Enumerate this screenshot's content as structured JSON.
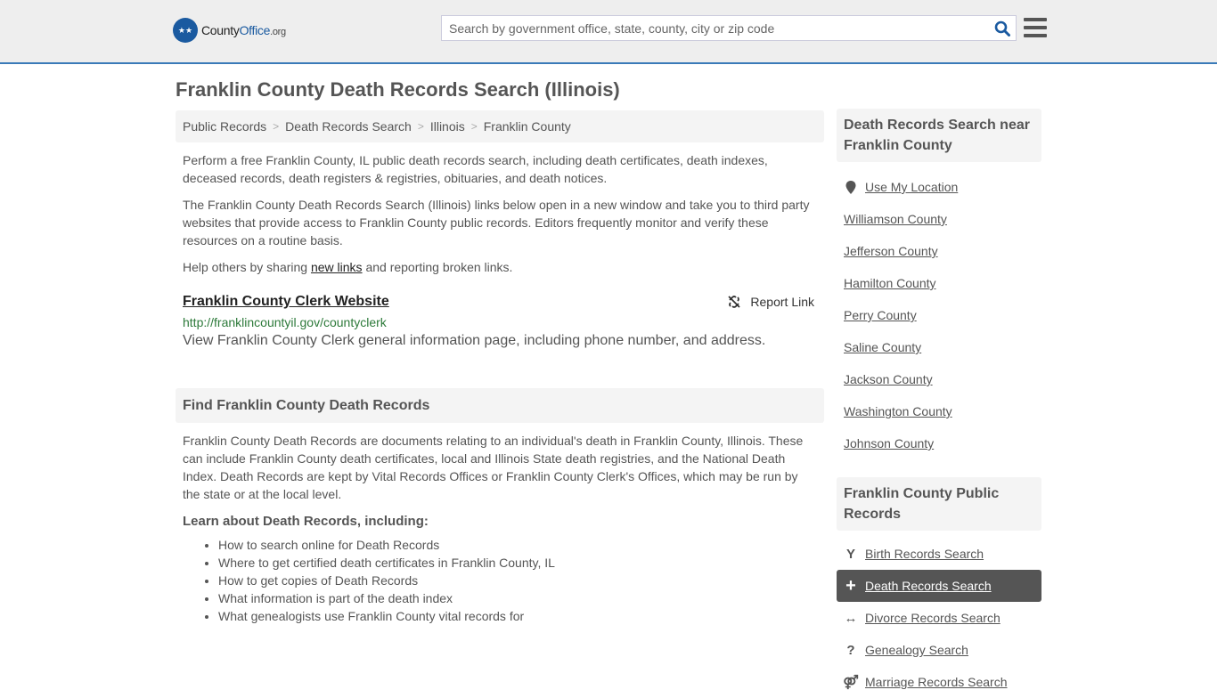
{
  "header": {
    "logo": {
      "name_part1": "County",
      "name_part2": "Office",
      "suffix": ".org"
    },
    "search": {
      "placeholder": "Search by government office, state, county, city or zip code",
      "value": ""
    }
  },
  "page": {
    "title": "Franklin County Death Records Search (Illinois)"
  },
  "breadcrumb": [
    {
      "label": "Public Records"
    },
    {
      "label": "Death Records Search"
    },
    {
      "label": "Illinois"
    },
    {
      "label": "Franklin County"
    }
  ],
  "intro": {
    "p1": "Perform a free Franklin County, IL public death records search, including death certificates, death indexes, deceased records, death registers & registries, obituaries, and death notices.",
    "p2": "The Franklin County Death Records Search (Illinois) links below open in a new window and take you to third party websites that provide access to Franklin County public records. Editors frequently monitor and verify these resources on a routine basis.",
    "p3_before": "Help others by sharing ",
    "p3_link": "new links",
    "p3_after": " and reporting broken links."
  },
  "links": [
    {
      "title": "Franklin County Clerk Website",
      "url": "http://franklincountyil.gov/countyclerk",
      "description": "View Franklin County Clerk general information page, including phone number, and address.",
      "report_label": "Report Link"
    }
  ],
  "find_section": {
    "title": "Find Franklin County Death Records",
    "body": "Franklin County Death Records are documents relating to an individual's death in Franklin County, Illinois. These can include Franklin County death certificates, local and Illinois State death registries, and the National Death Index. Death Records are kept by Vital Records Offices or Franklin County Clerk's Offices, which may be run by the state or at the local level.",
    "learn_title": "Learn about Death Records, including:",
    "learn_items": [
      "How to search online for Death Records",
      "Where to get certified death certificates in Franklin County, IL",
      "How to get copies of Death Records",
      "What information is part of the death index",
      "What genealogists use Franklin County vital records for"
    ]
  },
  "sidebar": {
    "nearby": {
      "title": "Death Records Search near Franklin County",
      "use_location": "Use My Location",
      "items": [
        "Williamson County",
        "Jefferson County",
        "Hamilton County",
        "Perry County",
        "Saline County",
        "Jackson County",
        "Washington County",
        "Johnson County"
      ]
    },
    "public_records": {
      "title": "Franklin County Public Records",
      "items": [
        {
          "label": "Birth Records Search",
          "icon": "child-icon",
          "active": false
        },
        {
          "label": "Death Records Search",
          "icon": "plus-icon",
          "active": true
        },
        {
          "label": "Divorce Records Search",
          "icon": "arrows-h-icon",
          "active": false
        },
        {
          "label": "Genealogy Search",
          "icon": "question-icon",
          "active": false
        },
        {
          "label": "Marriage Records Search",
          "icon": "marriage-icon",
          "active": false
        }
      ]
    }
  }
}
